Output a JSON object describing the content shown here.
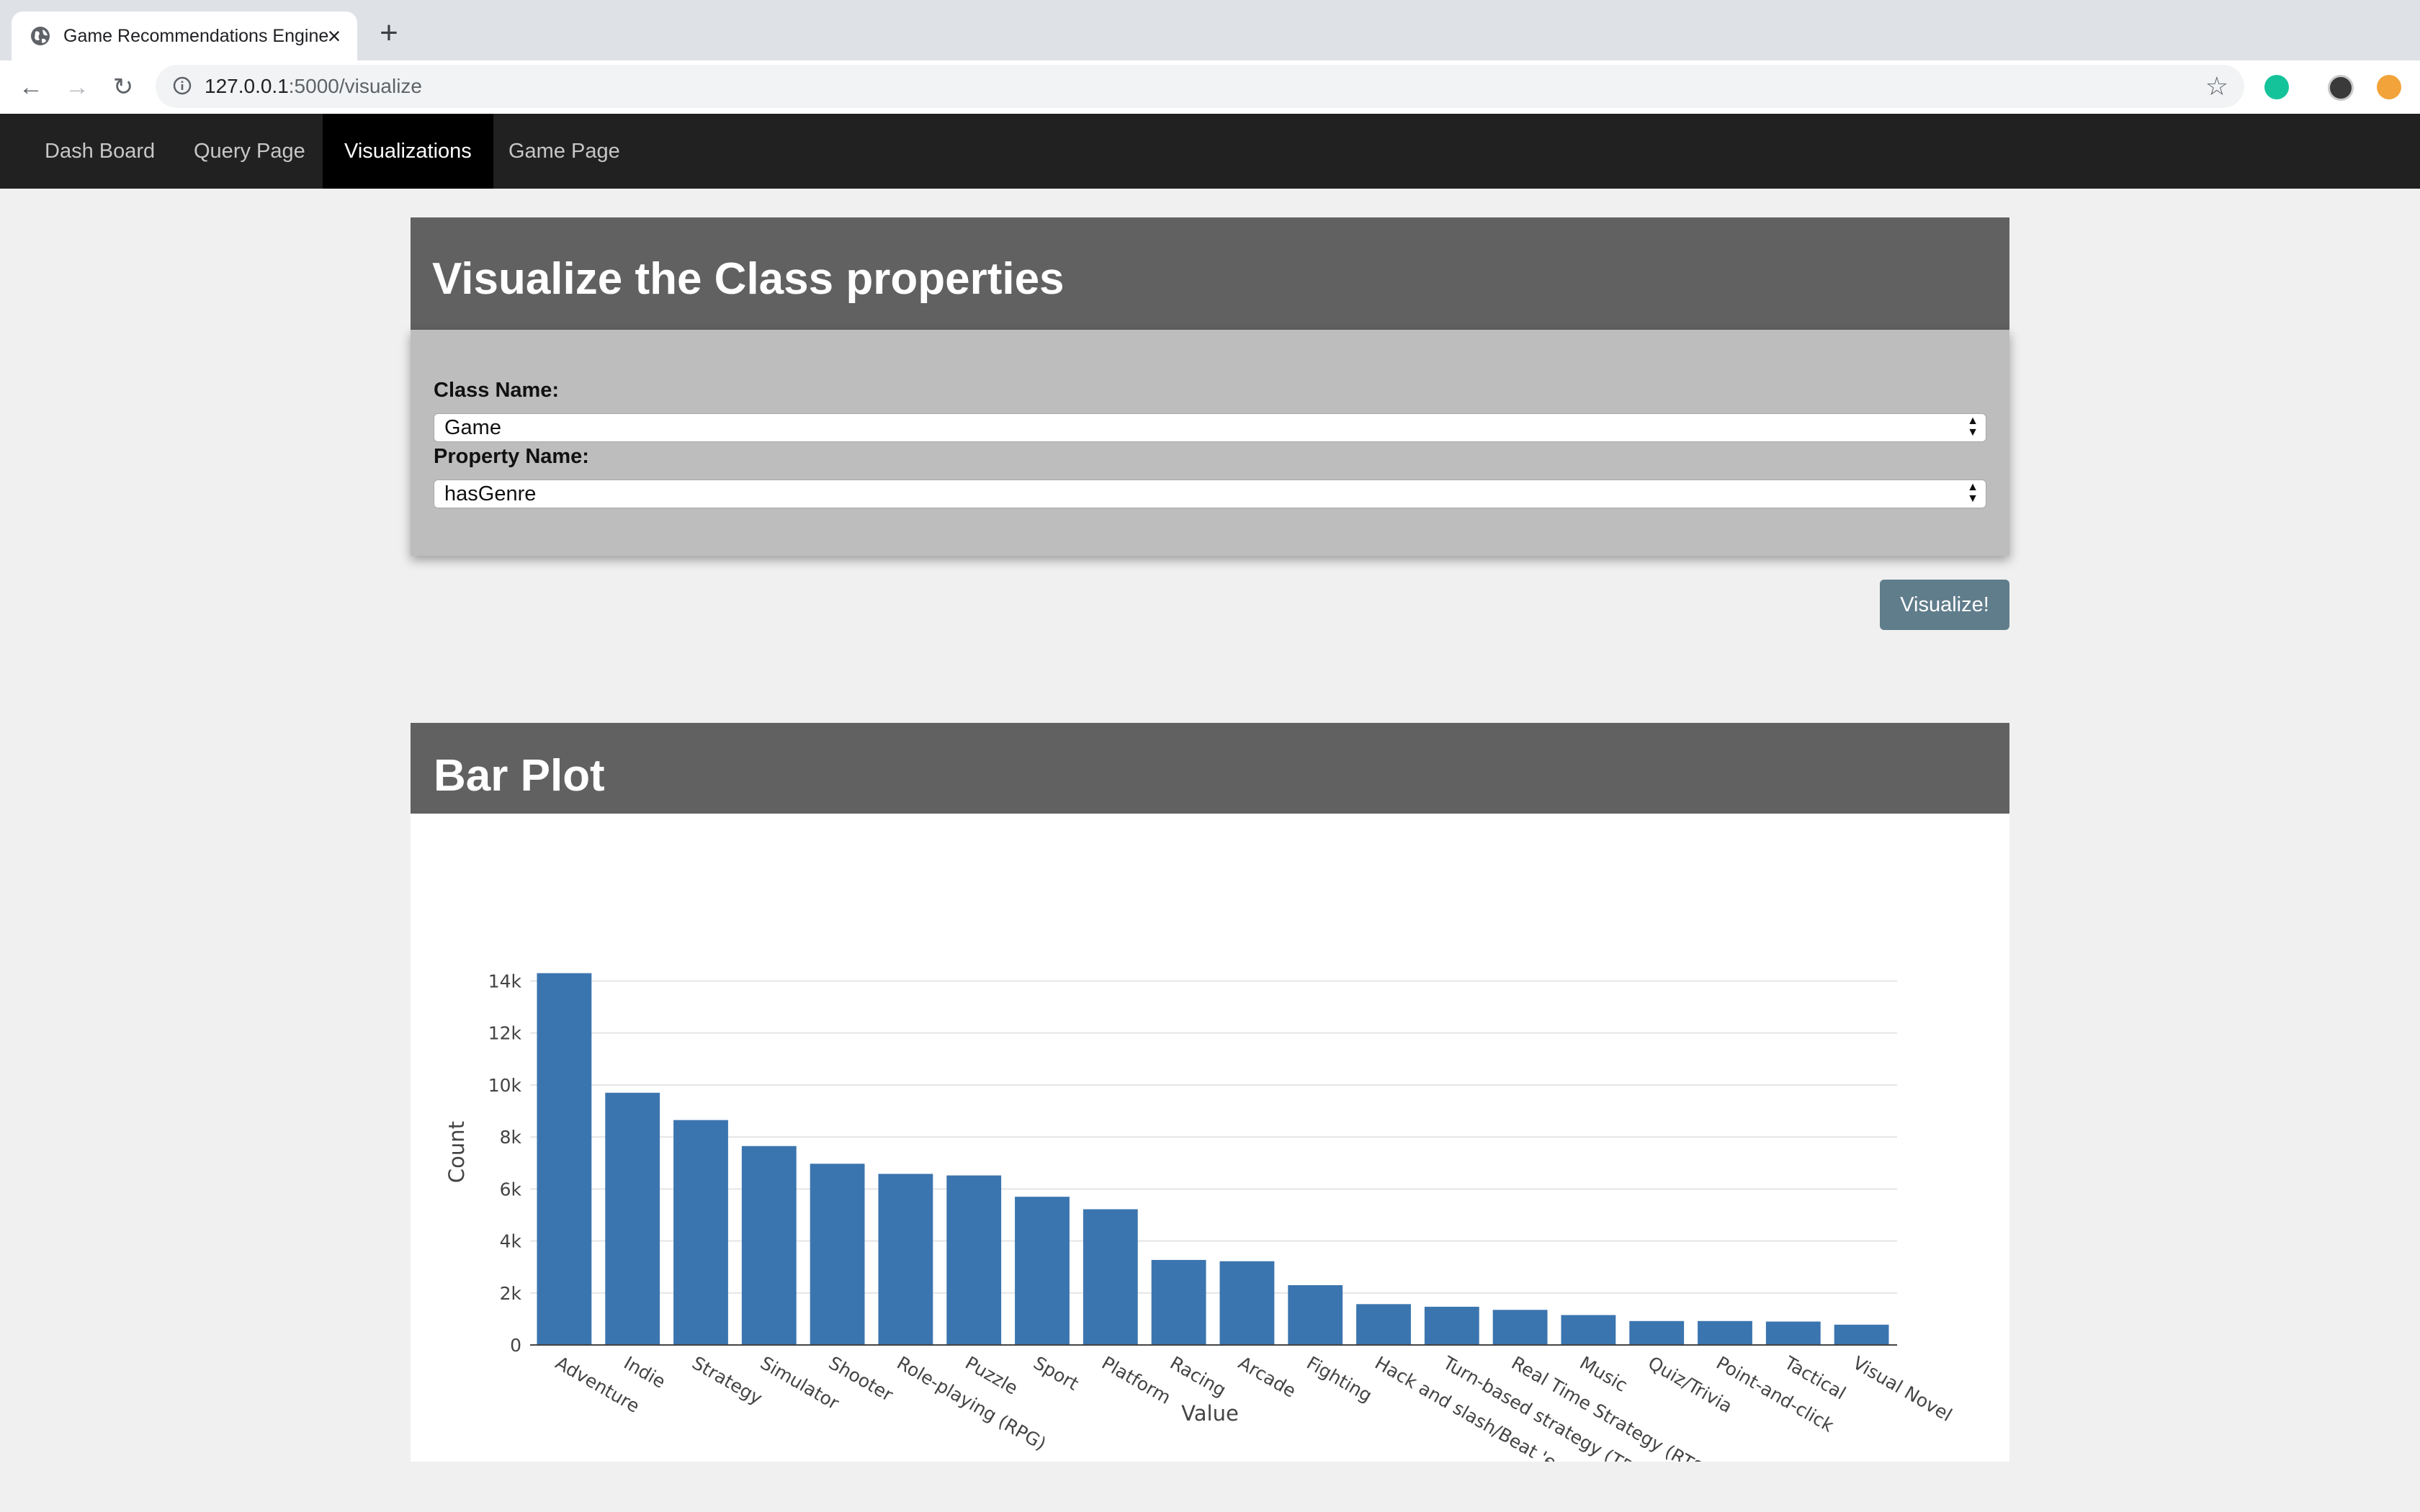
{
  "browser": {
    "tab_title": "Game Recommendations Engine",
    "url_host": "127.0.0.1",
    "url_path": ":5000/visualize",
    "icons": [
      "globe-icon",
      "close-icon",
      "plus-icon",
      "back-icon",
      "forward-icon",
      "reload-icon",
      "info-icon",
      "star-icon",
      "grammarly-icon",
      "profile-avatar",
      "extension-icon"
    ]
  },
  "nav": {
    "items": [
      "Dash Board",
      "Query Page",
      "Visualizations",
      "Game Page"
    ],
    "active": "Visualizations"
  },
  "form": {
    "title": "Visualize the Class properties",
    "class_label": "Class Name:",
    "class_value": "Game",
    "property_label": "Property Name:",
    "property_value": "hasGenre",
    "button_label": "Visualize!"
  },
  "plot": {
    "title": "Bar Plot"
  },
  "chart_data": {
    "type": "bar",
    "color": "#3b75af",
    "xlabel": "Value",
    "ylabel": "Count",
    "ylim": [
      0,
      14400
    ],
    "yticks": [
      0,
      2000,
      4000,
      6000,
      8000,
      10000,
      12000,
      14000
    ],
    "ytick_labels": [
      "0",
      "2k",
      "4k",
      "6k",
      "8k",
      "10k",
      "12k",
      "14k"
    ],
    "grid": true,
    "categories": [
      "Adventure",
      "Indie",
      "Strategy",
      "Simulator",
      "Shooter",
      "Role-playing (RPG)",
      "Puzzle",
      "Sport",
      "Platform",
      "Racing",
      "Arcade",
      "Fighting",
      "Hack and slash/Beat 'em up",
      "Turn-based strategy (TBS)",
      "Real Time Strategy (RTS)",
      "Music",
      "Quiz/Trivia",
      "Point-and-click",
      "Tactical",
      "Visual Novel"
    ],
    "values": [
      14300,
      9700,
      8650,
      7650,
      6970,
      6580,
      6520,
      5700,
      5220,
      3270,
      3220,
      2300,
      1570,
      1470,
      1350,
      1150,
      920,
      920,
      900,
      780
    ]
  }
}
